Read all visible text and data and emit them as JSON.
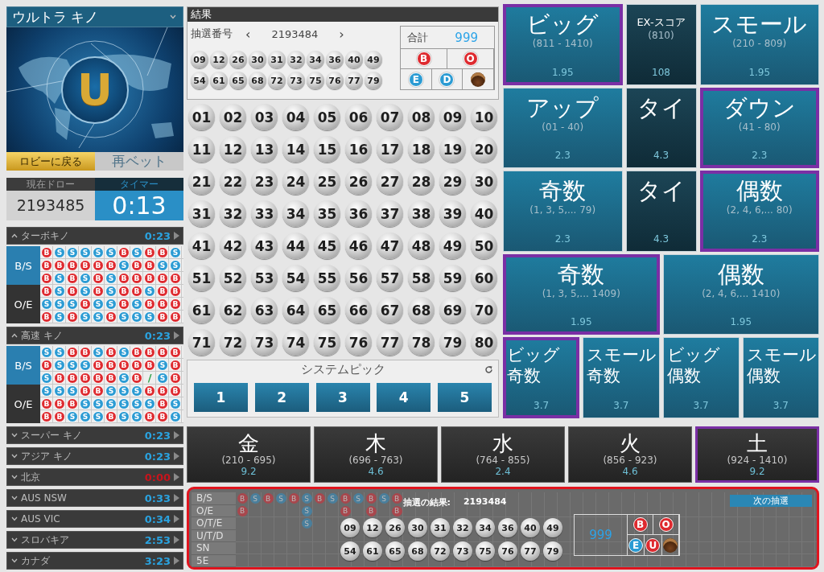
{
  "game_selector": {
    "title": "ウルトラ キノ"
  },
  "banner": {
    "logo_letter": "U"
  },
  "lobby_button": "ロビーに戻る",
  "rebet_button": "再ベット",
  "draw_info": {
    "current_label": "現在ドロー",
    "current_value": "2193485",
    "timer_label": "タイマー",
    "timer_value": "0:13"
  },
  "games": [
    {
      "name": "ターボキノ",
      "timer": "0:23",
      "color": "#2aa3e0",
      "expanded": true,
      "road_labels": [
        {
          "label": "B/S",
          "selected": true
        },
        {
          "label": "O/E",
          "selected": false
        }
      ],
      "road": [
        [
          {
            "kind": "ball",
            "text": "B",
            "color": "#de2a2f"
          },
          {
            "kind": "ball",
            "text": "S",
            "color": "#2b9bd3"
          },
          {
            "kind": "ball",
            "text": "S",
            "color": "#2b9bd3"
          },
          {
            "kind": "ball",
            "text": "S",
            "color": "#2b9bd3"
          },
          {
            "kind": "ball",
            "text": "S",
            "color": "#2b9bd3"
          },
          {
            "kind": "ball",
            "text": "S",
            "color": "#2b9bd3"
          },
          {
            "kind": "ball",
            "text": "B",
            "color": "#de2a2f"
          },
          {
            "kind": "ball",
            "text": "S",
            "color": "#2b9bd3"
          },
          {
            "kind": "ball",
            "text": "B",
            "color": "#de2a2f"
          },
          {
            "kind": "ball",
            "text": "B",
            "color": "#de2a2f"
          },
          {
            "kind": "ball",
            "text": "S",
            "color": "#2b9bd3"
          }
        ],
        [
          {
            "kind": "ball",
            "text": "B",
            "color": "#de2a2f"
          },
          {
            "kind": "ball",
            "text": "B",
            "color": "#de2a2f"
          },
          {
            "kind": "ball",
            "text": "B",
            "color": "#de2a2f"
          },
          {
            "kind": "ball",
            "text": "B",
            "color": "#de2a2f"
          },
          {
            "kind": "ball",
            "text": "B",
            "color": "#de2a2f"
          },
          {
            "kind": "ball",
            "text": "B",
            "color": "#de2a2f"
          },
          {
            "kind": "ball",
            "text": "S",
            "color": "#2b9bd3"
          },
          {
            "kind": "ball",
            "text": "B",
            "color": "#de2a2f"
          },
          {
            "kind": "ball",
            "text": "B",
            "color": "#de2a2f"
          },
          {
            "kind": "ball",
            "text": "S",
            "color": "#2b9bd3"
          },
          {
            "kind": "ball",
            "text": "S",
            "color": "#2b9bd3"
          }
        ],
        [
          {
            "kind": "ball",
            "text": "B",
            "color": "#de2a2f"
          },
          {
            "kind": "ball",
            "text": "S",
            "color": "#2b9bd3"
          },
          {
            "kind": "ball",
            "text": "B",
            "color": "#de2a2f"
          },
          {
            "kind": "ball",
            "text": "S",
            "color": "#2b9bd3"
          },
          {
            "kind": "ball",
            "text": "B",
            "color": "#de2a2f"
          },
          {
            "kind": "ball",
            "text": "S",
            "color": "#2b9bd3"
          },
          {
            "kind": "ball",
            "text": "B",
            "color": "#de2a2f"
          },
          {
            "kind": "ball",
            "text": "B",
            "color": "#de2a2f"
          },
          {
            "kind": "ball",
            "text": "B",
            "color": "#de2a2f"
          },
          {
            "kind": "ball",
            "text": "B",
            "color": "#de2a2f"
          },
          {
            "kind": "ball",
            "text": "B",
            "color": "#de2a2f"
          }
        ],
        [
          {
            "kind": "ball",
            "text": "B",
            "color": "#de2a2f"
          },
          {
            "kind": "ball",
            "text": "S",
            "color": "#2b9bd3"
          },
          {
            "kind": "ball",
            "text": "B",
            "color": "#de2a2f"
          },
          {
            "kind": "ball",
            "text": "S",
            "color": "#2b9bd3"
          },
          {
            "kind": "ball",
            "text": "B",
            "color": "#de2a2f"
          },
          {
            "kind": "ball",
            "text": "S",
            "color": "#2b9bd3"
          },
          {
            "kind": "ball",
            "text": "B",
            "color": "#de2a2f"
          },
          {
            "kind": "ball",
            "text": "B",
            "color": "#de2a2f"
          },
          {
            "kind": "ball",
            "text": "S",
            "color": "#2b9bd3"
          },
          {
            "kind": "ball",
            "text": "B",
            "color": "#de2a2f"
          },
          {
            "kind": "ball",
            "text": "B",
            "color": "#de2a2f"
          }
        ],
        [
          {
            "kind": "ball",
            "text": "S",
            "color": "#2b9bd3"
          },
          {
            "kind": "ball",
            "text": "S",
            "color": "#2b9bd3"
          },
          {
            "kind": "ball",
            "text": "S",
            "color": "#2b9bd3"
          },
          {
            "kind": "ball",
            "text": "B",
            "color": "#de2a2f"
          },
          {
            "kind": "ball",
            "text": "S",
            "color": "#2b9bd3"
          },
          {
            "kind": "ball",
            "text": "S",
            "color": "#2b9bd3"
          },
          {
            "kind": "ball",
            "text": "B",
            "color": "#de2a2f"
          },
          {
            "kind": "ball",
            "text": "S",
            "color": "#2b9bd3"
          },
          {
            "kind": "ball",
            "text": "B",
            "color": "#de2a2f"
          },
          {
            "kind": "ball",
            "text": "B",
            "color": "#de2a2f"
          },
          {
            "kind": "ball",
            "text": "B",
            "color": "#de2a2f"
          }
        ],
        [
          {
            "kind": "ball",
            "text": "B",
            "color": "#de2a2f"
          },
          {
            "kind": "ball",
            "text": "S",
            "color": "#2b9bd3"
          },
          {
            "kind": "ball",
            "text": "B",
            "color": "#de2a2f"
          },
          {
            "kind": "ball",
            "text": "S",
            "color": "#2b9bd3"
          },
          {
            "kind": "ball",
            "text": "S",
            "color": "#2b9bd3"
          },
          {
            "kind": "ball",
            "text": "B",
            "color": "#de2a2f"
          },
          {
            "kind": "ball",
            "text": "S",
            "color": "#2b9bd3"
          },
          {
            "kind": "ball",
            "text": "S",
            "color": "#2b9bd3"
          },
          {
            "kind": "ball",
            "text": "S",
            "color": "#2b9bd3"
          },
          {
            "kind": "ball",
            "text": "B",
            "color": "#de2a2f"
          },
          {
            "kind": "ball",
            "text": "B",
            "color": "#de2a2f"
          }
        ]
      ]
    },
    {
      "name": "高速 キノ",
      "timer": "0:23",
      "color": "#2aa3e0",
      "expanded": true,
      "road_labels": [
        {
          "label": "B/S",
          "selected": true
        },
        {
          "label": "O/E",
          "selected": false
        }
      ],
      "road": [
        [
          {
            "kind": "ball",
            "text": "S",
            "color": "#2b9bd3"
          },
          {
            "kind": "ball",
            "text": "S",
            "color": "#2b9bd3"
          },
          {
            "kind": "ball",
            "text": "B",
            "color": "#de2a2f"
          },
          {
            "kind": "ball",
            "text": "B",
            "color": "#de2a2f"
          },
          {
            "kind": "ball",
            "text": "S",
            "color": "#2b9bd3"
          },
          {
            "kind": "ball",
            "text": "B",
            "color": "#de2a2f"
          },
          {
            "kind": "ball",
            "text": "S",
            "color": "#2b9bd3"
          },
          {
            "kind": "ball",
            "text": "B",
            "color": "#de2a2f"
          },
          {
            "kind": "ball",
            "text": "B",
            "color": "#de2a2f"
          },
          {
            "kind": "ball",
            "text": "B",
            "color": "#de2a2f"
          },
          {
            "kind": "ball",
            "text": "B",
            "color": "#de2a2f"
          }
        ],
        [
          {
            "kind": "ball",
            "text": "B",
            "color": "#de2a2f"
          },
          {
            "kind": "ball",
            "text": "S",
            "color": "#2b9bd3"
          },
          {
            "kind": "ball",
            "text": "S",
            "color": "#2b9bd3"
          },
          {
            "kind": "ball",
            "text": "S",
            "color": "#2b9bd3"
          },
          {
            "kind": "ball",
            "text": "B",
            "color": "#de2a2f"
          },
          {
            "kind": "ball",
            "text": "B",
            "color": "#de2a2f"
          },
          {
            "kind": "ball",
            "text": "B",
            "color": "#de2a2f"
          },
          {
            "kind": "ball",
            "text": "B",
            "color": "#de2a2f"
          },
          {
            "kind": "ball",
            "text": "B",
            "color": "#de2a2f"
          },
          {
            "kind": "ball",
            "text": "S",
            "color": "#2b9bd3"
          },
          {
            "kind": "ball",
            "text": "B",
            "color": "#de2a2f"
          }
        ],
        [
          {
            "kind": "ball",
            "text": "S",
            "color": "#2b9bd3"
          },
          {
            "kind": "ball",
            "text": "B",
            "color": "#de2a2f"
          },
          {
            "kind": "ball",
            "text": "B",
            "color": "#de2a2f"
          },
          {
            "kind": "ball",
            "text": "B",
            "color": "#de2a2f"
          },
          {
            "kind": "ball",
            "text": "B",
            "color": "#de2a2f"
          },
          {
            "kind": "ball",
            "text": "B",
            "color": "#de2a2f"
          },
          {
            "kind": "ball",
            "text": "S",
            "color": "#2b9bd3"
          },
          {
            "kind": "ball",
            "text": "B",
            "color": "#de2a2f"
          },
          {
            "kind": "line",
            "text": "/",
            "color": "#2fa24a"
          },
          {
            "kind": "ball",
            "text": "S",
            "color": "#2b9bd3"
          },
          {
            "kind": "ball",
            "text": "B",
            "color": "#de2a2f"
          }
        ],
        [
          {
            "kind": "ball",
            "text": "S",
            "color": "#2b9bd3"
          },
          {
            "kind": "ball",
            "text": "S",
            "color": "#2b9bd3"
          },
          {
            "kind": "ball",
            "text": "S",
            "color": "#2b9bd3"
          },
          {
            "kind": "ball",
            "text": "B",
            "color": "#de2a2f"
          },
          {
            "kind": "ball",
            "text": "B",
            "color": "#de2a2f"
          },
          {
            "kind": "ball",
            "text": "S",
            "color": "#2b9bd3"
          },
          {
            "kind": "ball",
            "text": "S",
            "color": "#2b9bd3"
          },
          {
            "kind": "ball",
            "text": "S",
            "color": "#2b9bd3"
          },
          {
            "kind": "ball",
            "text": "B",
            "color": "#de2a2f"
          },
          {
            "kind": "ball",
            "text": "B",
            "color": "#de2a2f"
          },
          {
            "kind": "ball",
            "text": "B",
            "color": "#de2a2f"
          }
        ],
        [
          {
            "kind": "ball",
            "text": "B",
            "color": "#de2a2f"
          },
          {
            "kind": "ball",
            "text": "B",
            "color": "#de2a2f"
          },
          {
            "kind": "ball",
            "text": "B",
            "color": "#de2a2f"
          },
          {
            "kind": "ball",
            "text": "S",
            "color": "#2b9bd3"
          },
          {
            "kind": "ball",
            "text": "S",
            "color": "#2b9bd3"
          },
          {
            "kind": "ball",
            "text": "S",
            "color": "#2b9bd3"
          },
          {
            "kind": "ball",
            "text": "S",
            "color": "#2b9bd3"
          },
          {
            "kind": "ball",
            "text": "S",
            "color": "#2b9bd3"
          },
          {
            "kind": "ball",
            "text": "S",
            "color": "#2b9bd3"
          },
          {
            "kind": "ball",
            "text": "B",
            "color": "#de2a2f"
          },
          {
            "kind": "ball",
            "text": "S",
            "color": "#2b9bd3"
          }
        ],
        [
          {
            "kind": "ball",
            "text": "B",
            "color": "#de2a2f"
          },
          {
            "kind": "ball",
            "text": "B",
            "color": "#de2a2f"
          },
          {
            "kind": "ball",
            "text": "S",
            "color": "#2b9bd3"
          },
          {
            "kind": "ball",
            "text": "S",
            "color": "#2b9bd3"
          },
          {
            "kind": "ball",
            "text": "S",
            "color": "#2b9bd3"
          },
          {
            "kind": "ball",
            "text": "B",
            "color": "#de2a2f"
          },
          {
            "kind": "ball",
            "text": "S",
            "color": "#2b9bd3"
          },
          {
            "kind": "ball",
            "text": "S",
            "color": "#2b9bd3"
          },
          {
            "kind": "ball",
            "text": "B",
            "color": "#de2a2f"
          },
          {
            "kind": "ball",
            "text": "B",
            "color": "#de2a2f"
          },
          {
            "kind": "ball",
            "text": "S",
            "color": "#2b9bd3"
          }
        ]
      ]
    },
    {
      "name": "スーパー キノ",
      "timer": "0:23",
      "color": "#2aa3e0",
      "expanded": false
    },
    {
      "name": "アジア キノ",
      "timer": "0:23",
      "color": "#2aa3e0",
      "expanded": false
    },
    {
      "name": "北京",
      "timer": "0:00",
      "color": "#c8141c",
      "expanded": false
    },
    {
      "name": "AUS NSW",
      "timer": "0:33",
      "color": "#2aa3e0",
      "expanded": false
    },
    {
      "name": "AUS VIC",
      "timer": "0:34",
      "color": "#2aa3e0",
      "expanded": false
    },
    {
      "name": "スロバキア",
      "timer": "2:53",
      "color": "#2aa3e0",
      "expanded": false
    },
    {
      "name": "カナダ",
      "timer": "3:23",
      "color": "#2aa3e0",
      "expanded": false
    }
  ],
  "results": {
    "title": "結果",
    "draw_label": "抽選番号",
    "prev": "‹",
    "draw_number": "2193484",
    "next": "›",
    "balls": [
      "09",
      "12",
      "26",
      "30",
      "31",
      "32",
      "34",
      "36",
      "40",
      "49",
      "54",
      "61",
      "65",
      "68",
      "72",
      "73",
      "75",
      "76",
      "77",
      "79"
    ],
    "sum_label": "合計",
    "sum": "999",
    "badges": [
      {
        "text": "B",
        "color": "#de2a2f"
      },
      {
        "text": "O",
        "color": "#de2a2f"
      },
      {
        "text": "E",
        "color": "#2b9bd3"
      },
      {
        "text": "D",
        "color": "#2b9bd3"
      }
    ]
  },
  "numbers": [
    "01",
    "02",
    "03",
    "04",
    "05",
    "06",
    "07",
    "08",
    "09",
    "10",
    "11",
    "12",
    "13",
    "14",
    "15",
    "16",
    "17",
    "18",
    "19",
    "20",
    "21",
    "22",
    "23",
    "24",
    "25",
    "26",
    "27",
    "28",
    "29",
    "30",
    "31",
    "32",
    "33",
    "34",
    "35",
    "36",
    "37",
    "38",
    "39",
    "40",
    "41",
    "42",
    "43",
    "44",
    "45",
    "46",
    "47",
    "48",
    "49",
    "50",
    "51",
    "52",
    "53",
    "54",
    "55",
    "56",
    "57",
    "58",
    "59",
    "60",
    "61",
    "62",
    "63",
    "64",
    "65",
    "66",
    "67",
    "68",
    "69",
    "70",
    "71",
    "72",
    "73",
    "74",
    "75",
    "76",
    "77",
    "78",
    "79",
    "80"
  ],
  "system_pick": {
    "title": "システムピック",
    "buttons": [
      "1",
      "2",
      "3",
      "4",
      "5"
    ]
  },
  "bets": [
    [
      {
        "kind": "main",
        "name": "ビッグ",
        "range": "(811 - 1410)",
        "odds": "1.95",
        "selected": true
      },
      {
        "kind": "score",
        "name": "EX-スコア",
        "range": "(810)",
        "odds": "108",
        "selected": false
      },
      {
        "kind": "main",
        "name": "スモール",
        "range": "(210 - 809)",
        "odds": "1.95",
        "selected": false
      }
    ],
    [
      {
        "kind": "main",
        "name": "アップ",
        "range": "(01 - 40)",
        "odds": "2.3",
        "selected": false
      },
      {
        "kind": "tie",
        "name": "タイ",
        "odds": "4.3",
        "selected": false
      },
      {
        "kind": "main",
        "name": "ダウン",
        "range": "(41 - 80)",
        "odds": "2.3",
        "selected": true
      }
    ],
    [
      {
        "kind": "main",
        "name": "奇数",
        "range": "(1, 3, 5,... 79)",
        "odds": "2.3",
        "selected": false
      },
      {
        "kind": "tie",
        "name": "タイ",
        "odds": "4.3",
        "selected": false
      },
      {
        "kind": "main",
        "name": "偶数",
        "range": "(2, 4, 6,... 80)",
        "odds": "2.3",
        "selected": true
      }
    ],
    [
      {
        "kind": "main",
        "name": "奇数",
        "range": "(1, 3, 5,... 1409)",
        "odds": "1.95",
        "selected": true
      },
      {
        "kind": "main",
        "name": "偶数",
        "range": "(2, 4, 6,... 1410)",
        "odds": "1.95",
        "selected": false
      }
    ],
    [
      {
        "kind": "combo",
        "name_lines": [
          "ビッグ",
          "奇数"
        ],
        "odds": "3.7",
        "selected": true
      },
      {
        "kind": "combo",
        "name_lines": [
          "スモール",
          "奇数"
        ],
        "odds": "3.7",
        "selected": false
      },
      {
        "kind": "combo",
        "name_lines": [
          "ビッグ",
          "偶数"
        ],
        "odds": "3.7",
        "selected": false
      },
      {
        "kind": "combo",
        "name_lines": [
          "スモール",
          "偶数"
        ],
        "odds": "3.7",
        "selected": false
      }
    ]
  ],
  "element_bets": [
    {
      "name": "金",
      "range": "(210 - 695)",
      "odds": "9.2",
      "selected": false
    },
    {
      "name": "木",
      "range": "(696 - 763)",
      "odds": "4.6",
      "selected": false
    },
    {
      "name": "水",
      "range": "(764 - 855)",
      "odds": "2.4",
      "selected": false
    },
    {
      "name": "火",
      "range": "(856 - 923)",
      "odds": "4.6",
      "selected": false
    },
    {
      "name": "土",
      "range": "(924 - 1410)",
      "odds": "9.2",
      "selected": true
    }
  ],
  "result_overlay": {
    "title": "抽選の結果:",
    "draw_number": "2193484",
    "next_button": "次の抽選",
    "road_rows": [
      {
        "label": "B/S",
        "marks": [
          {
            "kind": "mark",
            "text": "B",
            "color": "#a8474d"
          },
          {
            "kind": "mark",
            "text": "S",
            "color": "#4a7f9c"
          },
          {
            "kind": "mark",
            "text": "B",
            "color": "#a8474d"
          },
          {
            "kind": "mark",
            "text": "S",
            "color": "#4a7f9c"
          },
          {
            "kind": "mark",
            "text": "B",
            "color": "#a8474d"
          },
          {
            "kind": "mark",
            "text": "S",
            "color": "#4a7f9c"
          },
          {
            "kind": "mark",
            "text": "B",
            "color": "#a8474d"
          },
          {
            "kind": "mark",
            "text": "S",
            "color": "#4a7f9c"
          },
          {
            "kind": "mark",
            "text": "B",
            "color": "#a8474d"
          },
          {
            "kind": "mark",
            "text": "S",
            "color": "#4a7f9c"
          },
          {
            "kind": "mark",
            "text": "B",
            "color": "#a8474d"
          },
          {
            "kind": "mark",
            "text": "S",
            "color": "#4a7f9c"
          },
          {
            "kind": "mark",
            "text": "B",
            "color": "#a8474d"
          }
        ]
      },
      {
        "label": "O/E",
        "marks": [
          {
            "kind": "mark",
            "text": "B",
            "color": "#a8474d"
          },
          {
            "kind": "blank"
          },
          {
            "kind": "blank"
          },
          {
            "kind": "blank"
          },
          {
            "kind": "blank"
          },
          {
            "kind": "mark",
            "text": "S",
            "color": "#4a7f9c"
          },
          {
            "kind": "blank"
          },
          {
            "kind": "blank"
          },
          {
            "kind": "mark",
            "text": "B",
            "color": "#a8474d"
          },
          {
            "kind": "blank"
          },
          {
            "kind": "mark",
            "text": "B",
            "color": "#a8474d"
          },
          {
            "kind": "blank"
          },
          {
            "kind": "mark",
            "text": "B",
            "color": "#a8474d"
          }
        ]
      },
      {
        "label": "O/T/E",
        "marks": [
          {
            "kind": "blank"
          },
          {
            "kind": "blank"
          },
          {
            "kind": "blank"
          },
          {
            "kind": "blank"
          },
          {
            "kind": "blank"
          },
          {
            "kind": "mark",
            "text": "S",
            "color": "#4a7f9c"
          }
        ]
      },
      {
        "label": "U/T/D"
      },
      {
        "label": "SN"
      },
      {
        "label": "5E"
      }
    ],
    "balls": [
      "09",
      "12",
      "26",
      "30",
      "31",
      "32",
      "34",
      "36",
      "40",
      "49",
      "54",
      "61",
      "65",
      "68",
      "72",
      "73",
      "75",
      "76",
      "77",
      "79"
    ],
    "sum": "999",
    "badges": [
      {
        "text": "B",
        "color": "#de2a2f"
      },
      {
        "text": "O",
        "color": "#de2a2f"
      },
      {
        "text": "E",
        "color": "#2b9bd3"
      },
      {
        "text": "U",
        "color": "#de2a2f"
      }
    ]
  }
}
